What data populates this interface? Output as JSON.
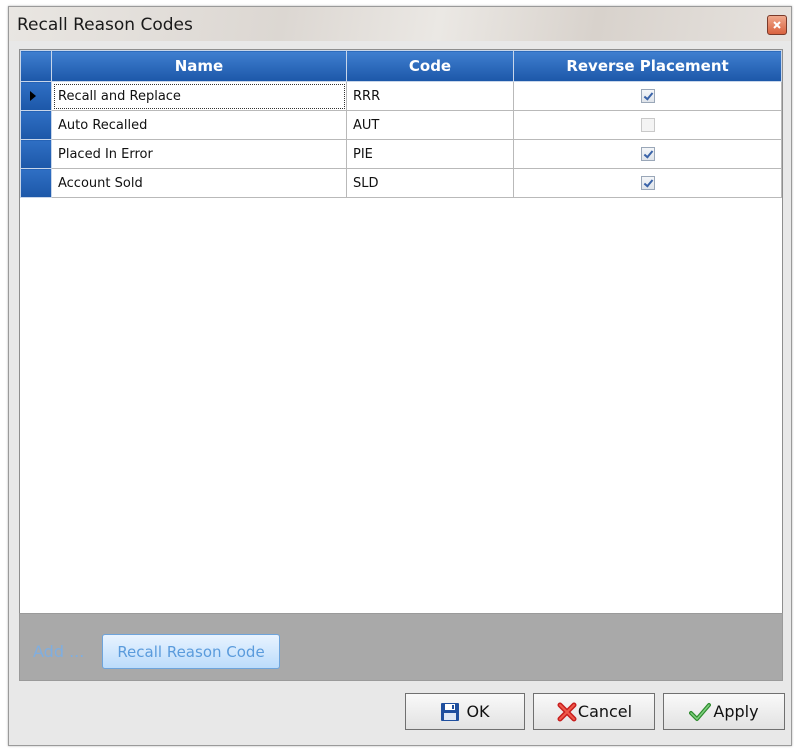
{
  "window": {
    "title": "Recall Reason Codes"
  },
  "grid": {
    "columns": [
      "Name",
      "Code",
      "Reverse Placement"
    ],
    "rows": [
      {
        "name": "Recall and Replace",
        "code": "RRR",
        "reverse_placement": true
      },
      {
        "name": "Auto Recalled",
        "code": "AUT",
        "reverse_placement": false
      },
      {
        "name": "Placed In Error",
        "code": "PIE",
        "reverse_placement": true
      },
      {
        "name": "Account Sold",
        "code": "SLD",
        "reverse_placement": true
      }
    ],
    "current_row": 0
  },
  "actions": {
    "add_label": "Add ...",
    "recall_reason_code_label": "Recall Reason Code"
  },
  "buttons": {
    "ok_label": "OK",
    "cancel_label": "Cancel",
    "apply_label": "Apply"
  },
  "colors": {
    "header_blue": "#1c57a8",
    "action_bar_gray": "#a9a9a9",
    "link_blue": "#7faee0"
  },
  "icons": {
    "close": "close-icon",
    "ok": "floppy-disk-icon",
    "cancel": "red-x-icon",
    "apply": "green-checkmark-icon"
  }
}
